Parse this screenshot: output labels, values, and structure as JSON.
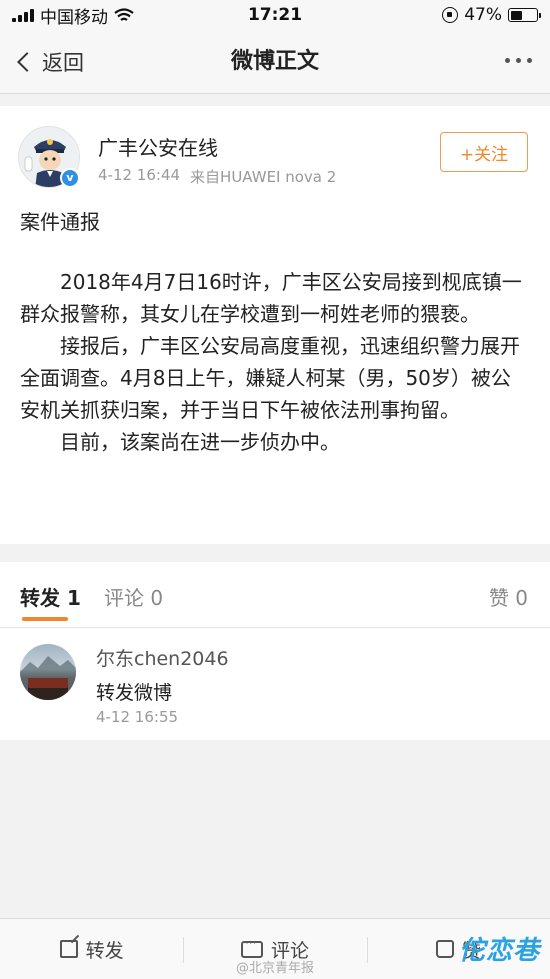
{
  "status_bar": {
    "carrier": "中国移动",
    "time": "17:21",
    "battery": "47%",
    "battery_level": 0.47
  },
  "nav": {
    "back_label": "返回",
    "title": "微博正文"
  },
  "post": {
    "author": "广丰公安在线",
    "date": "4-12 16:44",
    "source": "来自HUAWEI nova 2",
    "follow_label": "+关注",
    "heading": "案件通报",
    "paragraphs": [
      "　　2018年4月7日16时许，广丰区公安局接到枧底镇一群众报警称，其女儿在学校遭到一柯姓老师的猥亵。",
      "　　接报后，广丰区公安局高度重视，迅速组织警力展开全面调查。4月8日上午，嫌疑人柯某（男，50岁）被公安机关抓获归案，并于当日下午被依法刑事拘留。",
      "　　目前，该案尚在进一步侦办中。"
    ]
  },
  "tabs": {
    "repost": "转发 1",
    "comment": "评论 0",
    "like": "赞 0"
  },
  "reposts": [
    {
      "user": "尔东chen2046",
      "text": "转发微博",
      "time": "4-12 16:55"
    }
  ],
  "bottom_bar": {
    "repost": "转发",
    "comment": "评论",
    "like": "赞"
  },
  "watermark": {
    "text": "@北京青年报",
    "logo": "佗恋巷"
  },
  "colors": {
    "accent": "#f0882b",
    "verified": "#2f8fe0"
  }
}
